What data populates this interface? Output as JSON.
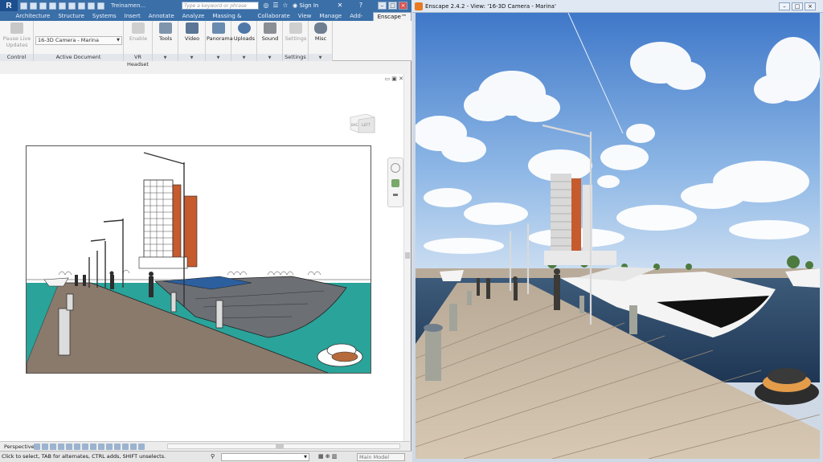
{
  "revit": {
    "app_button": "R",
    "title_fragment": "Treinamen...",
    "search_placeholder": "Type a keyword or phrase",
    "sign_in": "Sign In",
    "help": "?",
    "tabs": [
      "Architecture",
      "Structure",
      "Systems",
      "Insert",
      "Annotate",
      "Analyze",
      "Massing & Site",
      "Collaborate",
      "View",
      "Manage",
      "Add-Ins",
      "Enscape™"
    ],
    "ribbon": {
      "pause_live_updates": "Pause Live Updates",
      "control_label": "Control",
      "camera_value": "16-3D Camera - Marina",
      "active_document_label": "Active Document",
      "enable": "Enable",
      "vr_headset_label": "VR Headset",
      "tools": "Tools",
      "video": "Video",
      "panorama": "Panorama",
      "uploads": "Uploads",
      "sound": "Sound",
      "settings": "Settings",
      "settings_label": "Settings",
      "misc": "Misc"
    },
    "viewcube": {
      "left": "LEFT",
      "back": "BAC"
    },
    "view_bar": {
      "label": "Perspective"
    },
    "status": {
      "text": "Click to select, TAB for alternates, CTRL adds, SHIFT unselects.",
      "main_model": "Main Model"
    }
  },
  "enscape": {
    "title": "Enscape 2.4.2 - View: '16-3D Camera - Marina'"
  },
  "colors": {
    "revit_blue": "#3a6fa8",
    "water_teal": "#2aa39a",
    "tower_orange": "#c65b2e",
    "enscape_orange": "#e77a22"
  }
}
